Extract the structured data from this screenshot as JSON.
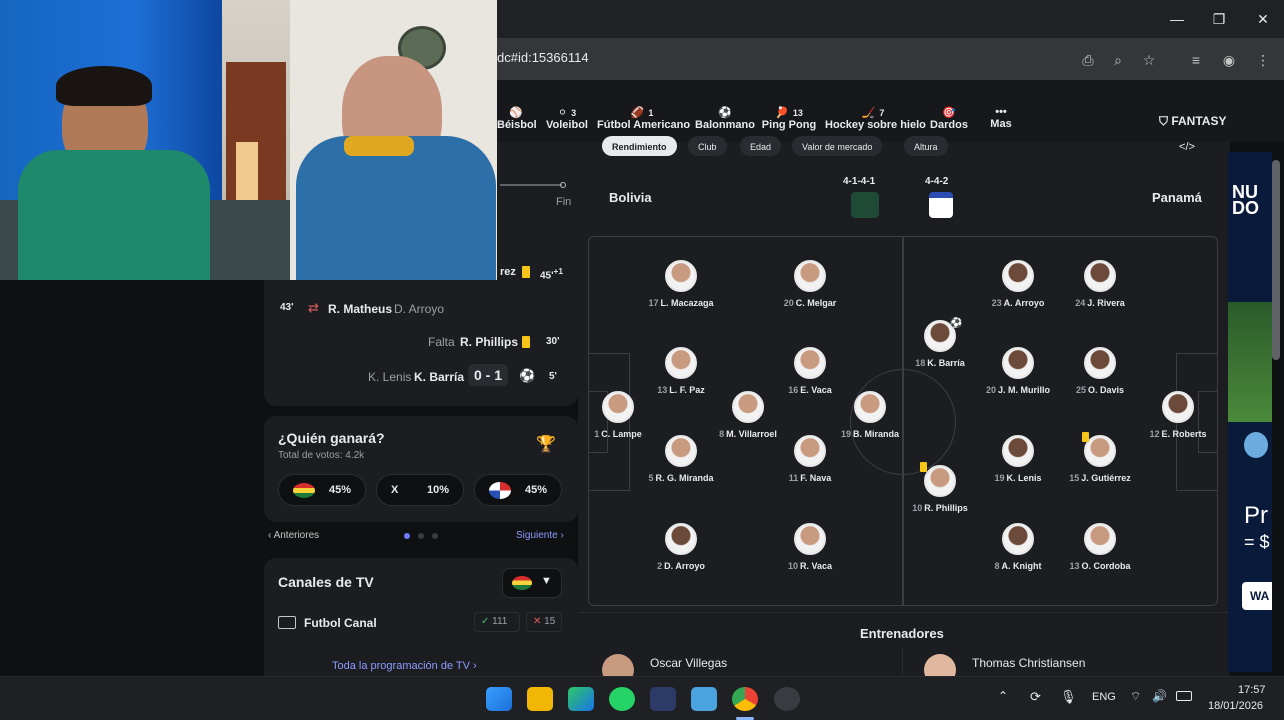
{
  "browser": {
    "url_fragment": "dc#id:15366114",
    "window_controls": [
      "—",
      "❐",
      "✕"
    ]
  },
  "sports_nav": [
    {
      "label": "Béisbol",
      "count": ""
    },
    {
      "label": "Voleibol",
      "count": "3"
    },
    {
      "label": "Fútbol Americano",
      "count": "1"
    },
    {
      "label": "Balonmano",
      "count": ""
    },
    {
      "label": "Ping Pong",
      "count": "13"
    },
    {
      "label": "Hockey sobre hielo",
      "count": "7"
    },
    {
      "label": "Dardos",
      "count": ""
    },
    {
      "label": "Mas",
      "count": ""
    }
  ],
  "fantasy_label": "FANTASY",
  "filter_tabs": [
    "Rendimiento",
    "Club",
    "Edad",
    "Valor de mercado",
    "Altura"
  ],
  "timeline": {
    "end_label": "Fin",
    "events": [
      {
        "minute": "45'",
        "plus": "+1",
        "text": "rez",
        "type": "yellow"
      },
      {
        "minute": "43'",
        "player": "R. Matheus",
        "sub": "D. Arroyo",
        "type": "substitution"
      },
      {
        "minute": "30'",
        "prefix": "Falta",
        "player": "R. Phillips",
        "type": "yellow"
      },
      {
        "minute": "5'",
        "prefix": "K. Lenis",
        "player": "K. Barría",
        "score": "0 - 1",
        "type": "goal"
      }
    ]
  },
  "poll": {
    "title": "¿Quién ganará?",
    "votes": "Total de votos: 4.2k",
    "home_pct": "45%",
    "draw_label": "X",
    "draw_pct": "10%",
    "away_pct": "45%",
    "prev": "Anteriores",
    "next": "Siguiente"
  },
  "tv": {
    "title": "Canales de TV",
    "channel": "Futbol Canal",
    "up_votes": "111",
    "down_votes": "15",
    "all_link": "Toda la programación de TV"
  },
  "lineup": {
    "home_team": "Bolivia",
    "away_team": "Panamá",
    "home_formation": "4-1-4-1",
    "away_formation": "4-4-2",
    "home_players": [
      {
        "num": "1",
        "name": "C. Lampe"
      },
      {
        "num": "13",
        "name": "L. F. Paz"
      },
      {
        "num": "5",
        "name": "R. G. Miranda"
      },
      {
        "num": "2",
        "name": "D. Arroyo"
      },
      {
        "num": "17",
        "name": "L. Macazaga"
      },
      {
        "num": "8",
        "name": "M. Villarroel"
      },
      {
        "num": "20",
        "name": "C. Melgar"
      },
      {
        "num": "16",
        "name": "E. Vaca"
      },
      {
        "num": "11",
        "name": "F. Nava"
      },
      {
        "num": "10",
        "name": "R. Vaca"
      },
      {
        "num": "19",
        "name": "B. Miranda"
      }
    ],
    "away_players": [
      {
        "num": "18",
        "name": "K. Barría"
      },
      {
        "num": "10",
        "name": "R. Phillips"
      },
      {
        "num": "23",
        "name": "A. Arroyo"
      },
      {
        "num": "20",
        "name": "J. M. Murillo"
      },
      {
        "num": "19",
        "name": "K. Lenis"
      },
      {
        "num": "8",
        "name": "A. Knight"
      },
      {
        "num": "24",
        "name": "J. Rivera"
      },
      {
        "num": "25",
        "name": "O. Davis"
      },
      {
        "num": "15",
        "name": "J. Gutiérrez"
      },
      {
        "num": "13",
        "name": "O. Cordoba"
      },
      {
        "num": "12",
        "name": "E. Roberts"
      }
    ],
    "coaches_title": "Entrenadores",
    "home_coach": "Oscar Villegas",
    "away_coach": "Thomas Christiansen"
  },
  "ad": {
    "text1": "NU",
    "text2": "DO",
    "text3": "Pr",
    "text4": "= $",
    "button": "WA"
  },
  "taskbar": {
    "lang": "ENG",
    "time": "17:57",
    "date": "18/01/2026"
  },
  "colors": {
    "accent": "#6e7bff",
    "yellow_card": "#f5c518",
    "bolivia_green": "#1f7a3a",
    "panama_white": "#ffffff"
  }
}
